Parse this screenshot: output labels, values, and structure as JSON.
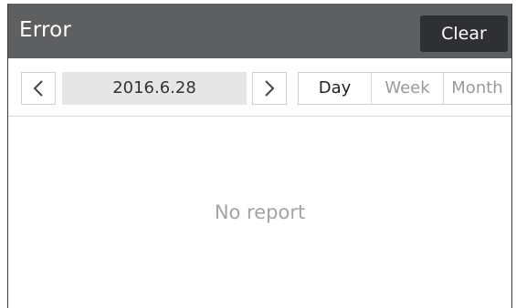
{
  "header": {
    "title": "Error",
    "clear_label": "Clear"
  },
  "toolbar": {
    "date": "2016.6.28",
    "prev_icon": "chevron-left-icon",
    "next_icon": "chevron-right-icon",
    "periods": [
      {
        "label": "Day",
        "active": true
      },
      {
        "label": "Week",
        "active": false
      },
      {
        "label": "Month",
        "active": false
      }
    ]
  },
  "content": {
    "empty_message": "No report"
  },
  "colors": {
    "header_bg": "#5e5f61",
    "button_bg": "#2f3033",
    "date_bg": "#e6e6e6",
    "muted_text": "#a3a3a3"
  }
}
